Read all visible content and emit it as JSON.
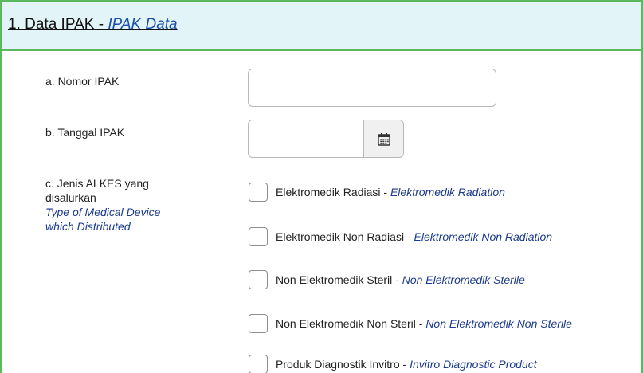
{
  "section": {
    "number_title": "1. Data IPAK",
    "separator": " - ",
    "title_en": "IPAK Data"
  },
  "fields": {
    "nomor_label": "a. Nomor IPAK",
    "nomor_value": "",
    "tanggal_label": "b. Tanggal IPAK",
    "tanggal_value": "",
    "jenis_label_line1": "c. Jenis ALKES yang",
    "jenis_label_line2": "disalurkan",
    "jenis_label_en_line1": "Type of Medical Device",
    "jenis_label_en_line2": "which Distributed"
  },
  "options": [
    {
      "id": "Elektromedik Radiasi",
      "en": "Elektromedik Radiation",
      "checked": false
    },
    {
      "id": "Elektromedik Non Radiasi",
      "en": "Elektromedik Non Radiation",
      "checked": false
    },
    {
      "id": "Non Elektromedik Steril",
      "en": "Non Elektromedik Sterile",
      "checked": false
    },
    {
      "id": "Non Elektromedik Non Steril",
      "en": "Non Elektromedik Non Sterile",
      "checked": false
    },
    {
      "id": "Produk Diagnostik Invitro",
      "en": "Invitro Diagnostic Product",
      "checked": false
    }
  ],
  "icons": {
    "date_picker": "calendar-icon"
  },
  "colors": {
    "header_bg": "#e2f4f8",
    "border": "#5cb85c",
    "english_text": "#1a3a8c"
  }
}
